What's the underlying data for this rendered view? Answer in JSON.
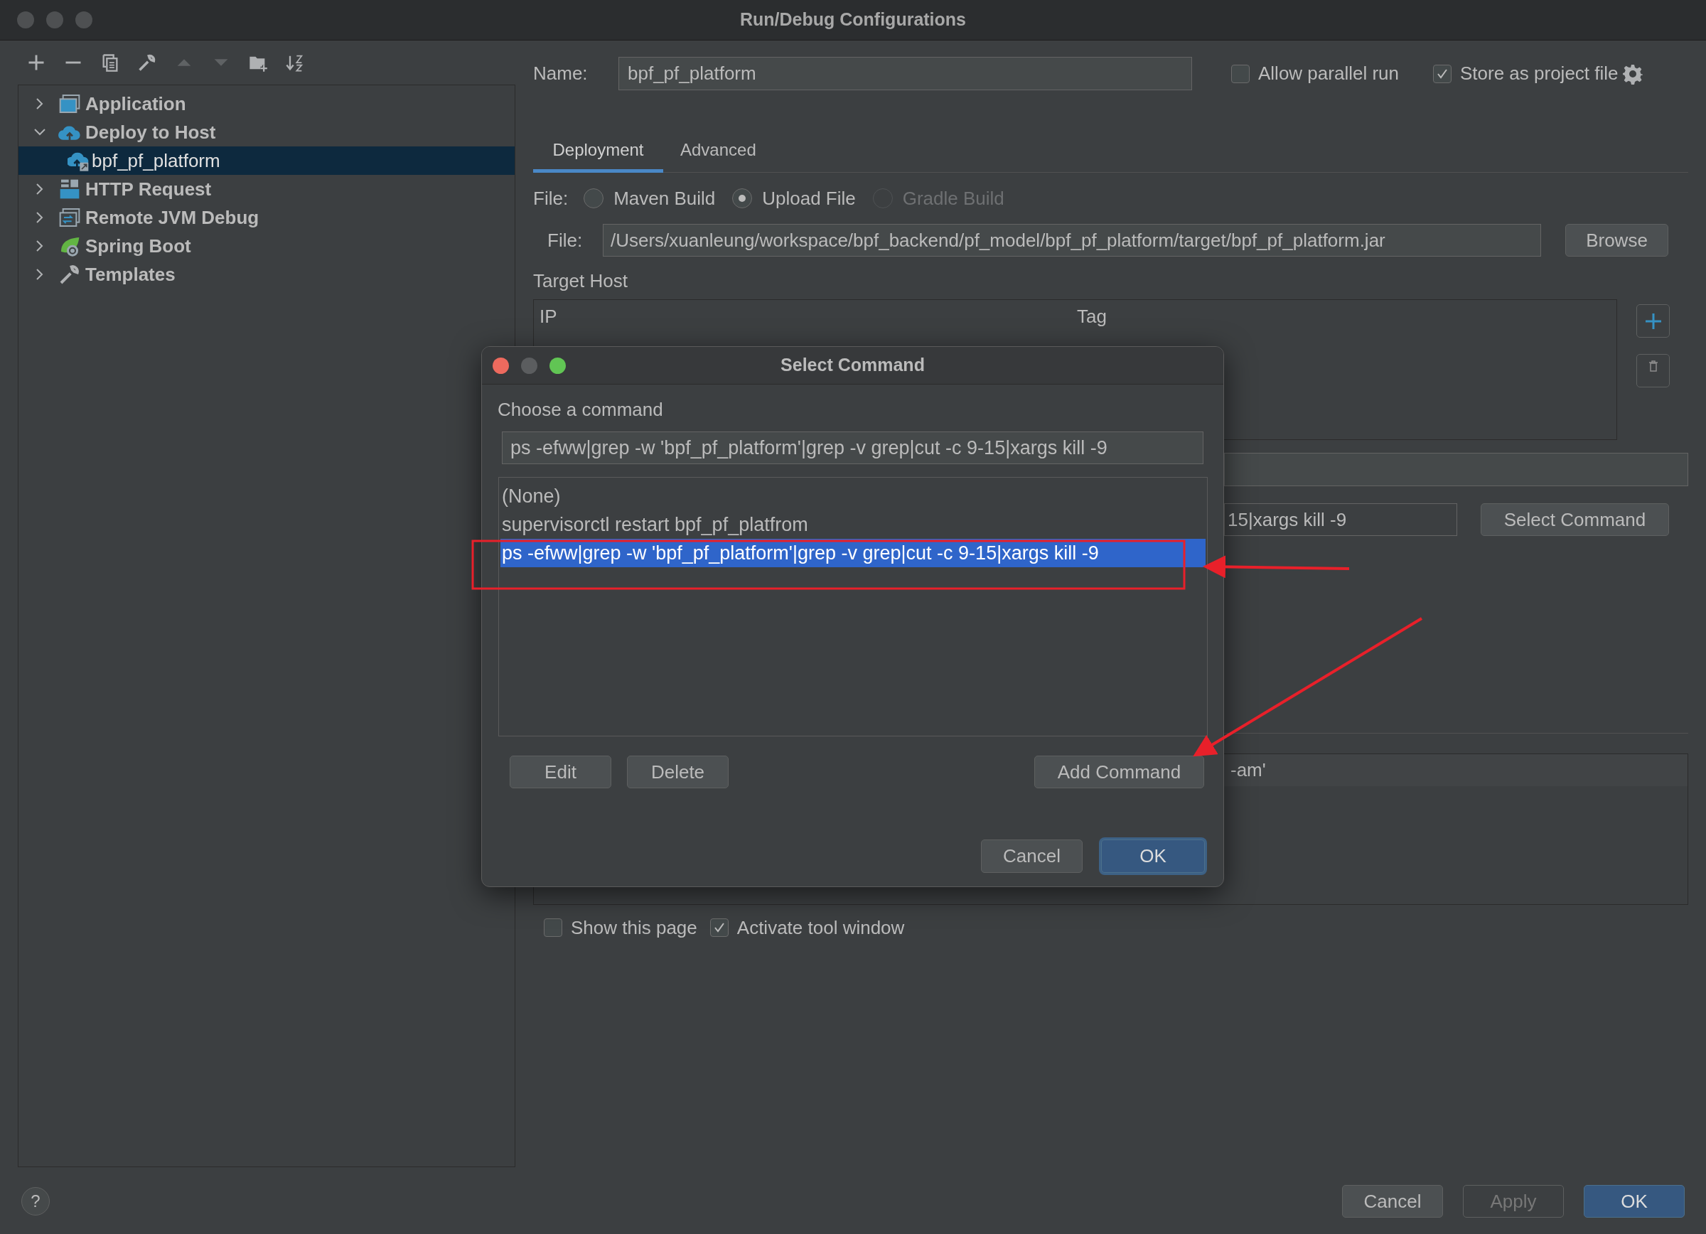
{
  "window": {
    "title": "Run/Debug Configurations"
  },
  "toolbar": [
    {
      "kind": "add",
      "disabled": false
    },
    {
      "kind": "remove",
      "disabled": false
    },
    {
      "kind": "copy",
      "disabled": false
    },
    {
      "kind": "edit",
      "disabled": false
    },
    {
      "kind": "up",
      "disabled": true
    },
    {
      "kind": "down",
      "disabled": true
    },
    {
      "kind": "folder",
      "disabled": false
    },
    {
      "kind": "sort",
      "disabled": false
    }
  ],
  "tree": [
    {
      "label": "Application",
      "kind": "application",
      "expanded": false,
      "selected": false
    },
    {
      "label": "Deploy to Host",
      "kind": "deploy",
      "expanded": true,
      "selected": false,
      "children": [
        {
          "label": "bpf_pf_platform",
          "kind": "deploy-config",
          "selected": true
        }
      ]
    },
    {
      "label": "HTTP Request",
      "kind": "http",
      "expanded": false,
      "selected": false
    },
    {
      "label": "Remote JVM Debug",
      "kind": "remote",
      "expanded": false,
      "selected": false
    },
    {
      "label": "Spring Boot",
      "kind": "spring",
      "expanded": false,
      "selected": false
    },
    {
      "label": "Templates",
      "kind": "templates",
      "expanded": false,
      "selected": false
    }
  ],
  "name_field": {
    "label": "Name:",
    "value": "bpf_pf_platform"
  },
  "options": [
    {
      "label": "Allow parallel run",
      "checked": false
    },
    {
      "label": "Store as project file",
      "checked": true
    }
  ],
  "tabs": [
    {
      "label": "Deployment",
      "selected": true
    },
    {
      "label": "Advanced",
      "selected": false
    }
  ],
  "file_source": {
    "label": "File:",
    "options": [
      {
        "label": "Maven Build",
        "selected": false,
        "disabled": false
      },
      {
        "label": "Upload File",
        "selected": true,
        "disabled": false
      },
      {
        "label": "Gradle Build",
        "selected": false,
        "disabled": true
      }
    ]
  },
  "file_path": {
    "label": "File:",
    "value": "/Users/xuanleung/workspace/bpf_backend/pf_model/bpf_pf_platform/target/bpf_pf_platform.jar",
    "button": "Browse"
  },
  "target_host": {
    "title": "Target Host",
    "columns": [
      "IP",
      "Tag"
    ]
  },
  "command_field": {
    "value": "15|xargs kill -9",
    "button": "Select Command"
  },
  "log_line": "-am'",
  "after_options": [
    {
      "label": "Show this page",
      "checked": false
    },
    {
      "label": "Activate tool window",
      "checked": true
    }
  ],
  "footer": {
    "help": "?",
    "buttons": [
      {
        "label": "Cancel",
        "kind": "normal"
      },
      {
        "label": "Apply",
        "kind": "disabled"
      },
      {
        "label": "OK",
        "kind": "default"
      }
    ]
  },
  "dialog": {
    "title": "Select Command",
    "prompt": "Choose a command",
    "value": "ps -efww|grep -w 'bpf_pf_platform'|grep -v grep|cut -c 9-15|xargs kill -9",
    "commands": [
      {
        "label": "(None)",
        "selected": false
      },
      {
        "label": "supervisorctl restart bpf_pf_platfrom",
        "selected": false
      },
      {
        "label": "ps -efww|grep -w 'bpf_pf_platform'|grep -v grep|cut -c 9-15|xargs kill -9",
        "selected": true
      }
    ],
    "actions": [
      "Edit",
      "Delete",
      "Add Command"
    ],
    "buttons": [
      {
        "label": "Cancel",
        "kind": "normal"
      },
      {
        "label": "OK",
        "kind": "default"
      }
    ]
  }
}
